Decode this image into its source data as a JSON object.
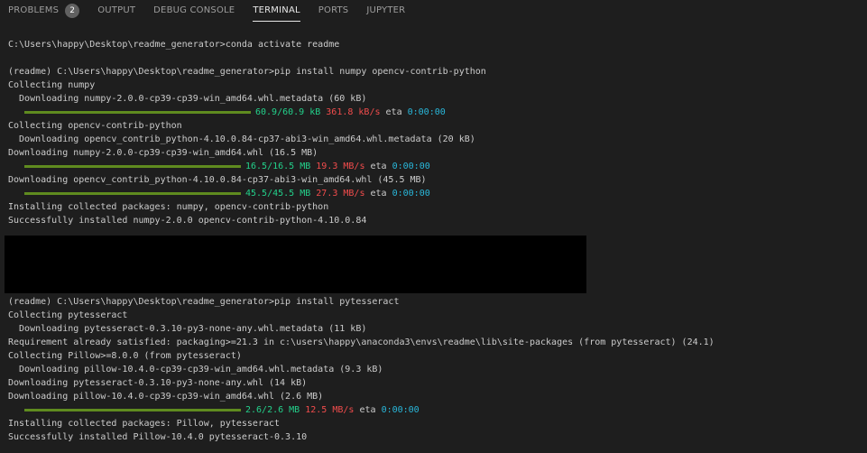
{
  "tabs": [
    {
      "label": "PROBLEMS",
      "badge": "2"
    },
    {
      "label": "OUTPUT"
    },
    {
      "label": "DEBUG CONSOLE"
    },
    {
      "label": "TERMINAL",
      "active": true
    },
    {
      "label": "PORTS"
    },
    {
      "label": "JUPYTER"
    }
  ],
  "terminal": {
    "block1": [
      "C:\\Users\\happy\\Desktop\\readme_generator>conda activate readme"
    ],
    "block2": {
      "l1": "(readme) C:\\Users\\happy\\Desktop\\readme_generator>pip install numpy opencv-contrib-python",
      "l2": "Collecting numpy",
      "l3": "  Downloading numpy-2.0.0-cp39-cp39-win_amd64.whl.metadata (60 kB)",
      "p1": {
        "progress": 1.0,
        "size": "60.9/60.9 kB",
        "speed": "361.8 kB/s",
        "eta_label": "eta",
        "eta": "0:00:00"
      },
      "l4": "Collecting opencv-contrib-python",
      "l5": "  Downloading opencv_contrib_python-4.10.0.84-cp37-abi3-win_amd64.whl.metadata (20 kB)",
      "l6": "Downloading numpy-2.0.0-cp39-cp39-win_amd64.whl (16.5 MB)",
      "p2": {
        "progress": 1.0,
        "size": "16.5/16.5 MB",
        "speed": "19.3 MB/s",
        "eta_label": "eta",
        "eta": "0:00:00"
      },
      "l7": "Downloading opencv_contrib_python-4.10.0.84-cp37-abi3-win_amd64.whl (45.5 MB)",
      "p3": {
        "progress": 1.0,
        "size": "45.5/45.5 MB",
        "speed": "27.3 MB/s",
        "eta_label": "eta",
        "eta": "0:00:00"
      },
      "l8": "Installing collected packages: numpy, opencv-contrib-python",
      "l9": "Successfully installed numpy-2.0.0 opencv-contrib-python-4.10.0.84"
    },
    "block3": {
      "l1": "(readme) C:\\Users\\happy\\Desktop\\readme_generator>pip install pytesseract",
      "l2": "Collecting pytesseract",
      "l3": "  Downloading pytesseract-0.3.10-py3-none-any.whl.metadata (11 kB)",
      "l4": "Requirement already satisfied: packaging>=21.3 in c:\\users\\happy\\anaconda3\\envs\\readme\\lib\\site-packages (from pytesseract) (24.1)",
      "l5": "Collecting Pillow>=8.0.0 (from pytesseract)",
      "l6": "  Downloading pillow-10.4.0-cp39-cp39-win_amd64.whl.metadata (9.3 kB)",
      "l7": "Downloading pytesseract-0.3.10-py3-none-any.whl (14 kB)",
      "l8": "Downloading pillow-10.4.0-cp39-cp39-win_amd64.whl (2.6 MB)",
      "p1": {
        "progress": 1.0,
        "size": "2.6/2.6 MB",
        "speed": "12.5 MB/s",
        "eta_label": "eta",
        "eta": "0:00:00"
      },
      "l9": "Installing collected packages: Pillow, pytesseract",
      "l10": "Successfully installed Pillow-10.4.0 pytesseract-0.3.10"
    }
  },
  "colors": {
    "background": "#1e1e1e",
    "text": "#cccccc",
    "progress_bar": "#5f8b1f",
    "size_text": "#23d18b",
    "speed_text": "#f14c4c",
    "eta_text": "#29b8db",
    "redaction": "#000000"
  }
}
